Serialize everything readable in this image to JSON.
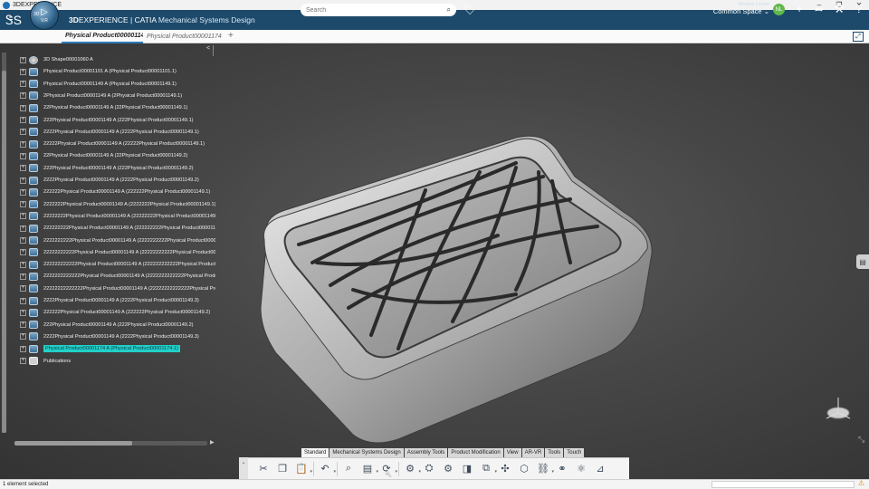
{
  "window": {
    "title": "3DEXPERIENCE",
    "minimize": "–",
    "maximize": "❐",
    "close": "✕"
  },
  "header": {
    "brand_bold": "3D",
    "brand_rest": "EXPERIENCE | CATIA ",
    "app_name": "Mechanical Systems Design",
    "compass_version": "V.R",
    "compass_3d": "3D",
    "search_placeholder": "Search",
    "user_name": "Nicolas Leune",
    "space": "Common Space",
    "avatar_initials": "NL"
  },
  "tabs": {
    "active": "Physical Product00000114!",
    "inactive": "Physical Product00001174",
    "add": "+"
  },
  "tree": {
    "collapse": "<",
    "items": [
      {
        "label": "3D Shape00001060 A",
        "icon": "shape"
      },
      {
        "label": "Physical Product00001101 A (Physical Product00001101.1)",
        "icon": "product"
      },
      {
        "label": "Physical Product00001149 A (Physical Product00001149.1)",
        "icon": "product"
      },
      {
        "label": "2Physical Product00001149 A (2Physical Product00001149.1)",
        "icon": "product"
      },
      {
        "label": "22Physical Product00001149 A (22Physical Product00001149.1)",
        "icon": "product"
      },
      {
        "label": "222Physical Product00001149 A (222Physical Product00001149.1)",
        "icon": "product"
      },
      {
        "label": "2222Physical Product00001149 A (2222Physical Product00001149.1)",
        "icon": "product"
      },
      {
        "label": "22222Physical Product00001149 A (22222Physical Product00001149.1)",
        "icon": "product"
      },
      {
        "label": "22Physical Product00001149 A (22Physical Product00001149.2)",
        "icon": "product"
      },
      {
        "label": "222Physical Product00001149 A (222Physical Product00001149.2)",
        "icon": "product"
      },
      {
        "label": "2222Physical Product00001149 A (2222Physical Product00001149.2)",
        "icon": "product"
      },
      {
        "label": "222222Physical Product00001149 A (222222Physical Product00001149.1)",
        "icon": "product"
      },
      {
        "label": "2222222Physical Product00001149 A (2222222Physical Product00001149.1)",
        "icon": "product"
      },
      {
        "label": "22222222Physical Product00001149 A (22222222Physical Product00001149.",
        "icon": "product"
      },
      {
        "label": "222222222Physical Product00001149 A (222222222Physical Product000011",
        "icon": "product"
      },
      {
        "label": "2222222222Physical Product00001149 A (2222222222Physical Product0000",
        "icon": "product"
      },
      {
        "label": "22222222222Physical Product00001149 A (22222222222Physical Product00",
        "icon": "product"
      },
      {
        "label": "222222222222Physical Product00001149 A (222222222222Physical Product",
        "icon": "product"
      },
      {
        "label": "2222222222222Physical Product00001149 A (2222222222222Physical Product00",
        "icon": "product"
      },
      {
        "label": "22222222222222Physical Product00001149 A (22222222222222Physical Produ",
        "icon": "product"
      },
      {
        "label": "2222Physical Product00001149 A (2222Physical Product00001149.3)",
        "icon": "product"
      },
      {
        "label": "222222Physical Product00001149 A (222222Physical Product00001149.2)",
        "icon": "product"
      },
      {
        "label": "222Physical Product00001149 A (222Physical Product00001149.2)",
        "icon": "product"
      },
      {
        "label": "2222Physical Product00001149 A (2222Physical Product00001149.3)",
        "icon": "product"
      },
      {
        "label": "Physical Product00001174 A (Physical Product00001174.1)",
        "icon": "product",
        "selected": true
      },
      {
        "label": "Publications",
        "icon": "pub"
      }
    ]
  },
  "action_bar": {
    "sections": [
      "Standard",
      "Mechanical Systems Design",
      "Assembly Tools",
      "Product Modification",
      "View",
      "AR-VR",
      "Tools",
      "Touch"
    ],
    "active_section": "Standard",
    "tools": [
      {
        "name": "cut-icon",
        "glyph": "✂"
      },
      {
        "name": "copy-icon",
        "glyph": "❐"
      },
      {
        "name": "paste-icon",
        "glyph": "📋",
        "caret": true
      },
      {
        "name": "undo-icon",
        "glyph": "↶",
        "caret": true
      },
      {
        "name": "zoom-fit-icon",
        "glyph": "⌕"
      },
      {
        "name": "book-icon",
        "glyph": "▤",
        "caret": true
      },
      {
        "name": "update-icon",
        "glyph": "⟳",
        "caret": true
      },
      {
        "name": "insert-product-icon",
        "glyph": "⚙",
        "caret": true
      },
      {
        "name": "replace-icon",
        "glyph": "⛭"
      },
      {
        "name": "assembly-icon",
        "glyph": "⚙"
      },
      {
        "name": "section-icon",
        "glyph": "◨"
      },
      {
        "name": "explode-icon",
        "glyph": "⧉",
        "caret": true
      },
      {
        "name": "constraint-icon",
        "glyph": "✣"
      },
      {
        "name": "engineering-connection-icon",
        "glyph": "⬡"
      },
      {
        "name": "fasten-icon",
        "glyph": "⛓",
        "caret": true
      },
      {
        "name": "clash-icon",
        "glyph": "⚭"
      },
      {
        "name": "mechanism-icon",
        "glyph": "⚛"
      },
      {
        "name": "measure-icon",
        "glyph": "⊿"
      }
    ]
  },
  "status": {
    "text": "1 element selected",
    "warning": "⚠"
  },
  "colors": {
    "header": "#1d4a6b",
    "selection": "#22d0c8",
    "viewport": "#464646"
  }
}
